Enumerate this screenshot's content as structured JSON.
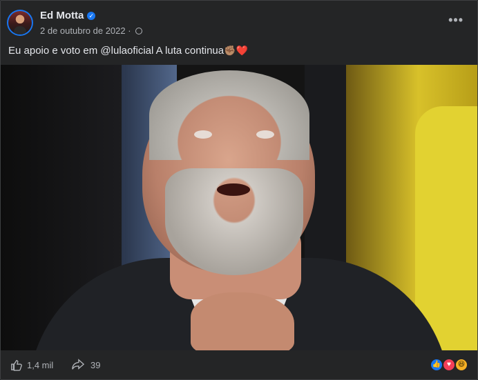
{
  "post": {
    "author": "Ed Motta",
    "date": "2 de outubro de 2022",
    "text": "Eu apoio e voto em @lulaoficial A luta continua",
    "text_emojis": "✊🏽❤️"
  },
  "footer": {
    "likes": "1,4 mil",
    "shares": "39"
  },
  "icons": {
    "verified": "verified-badge-icon",
    "privacy": "globe-icon",
    "more": "more-options-icon",
    "like": "thumbs-up-icon",
    "share": "share-arrow-icon"
  },
  "colors": {
    "background": "#242526",
    "accent": "#1877f2"
  }
}
